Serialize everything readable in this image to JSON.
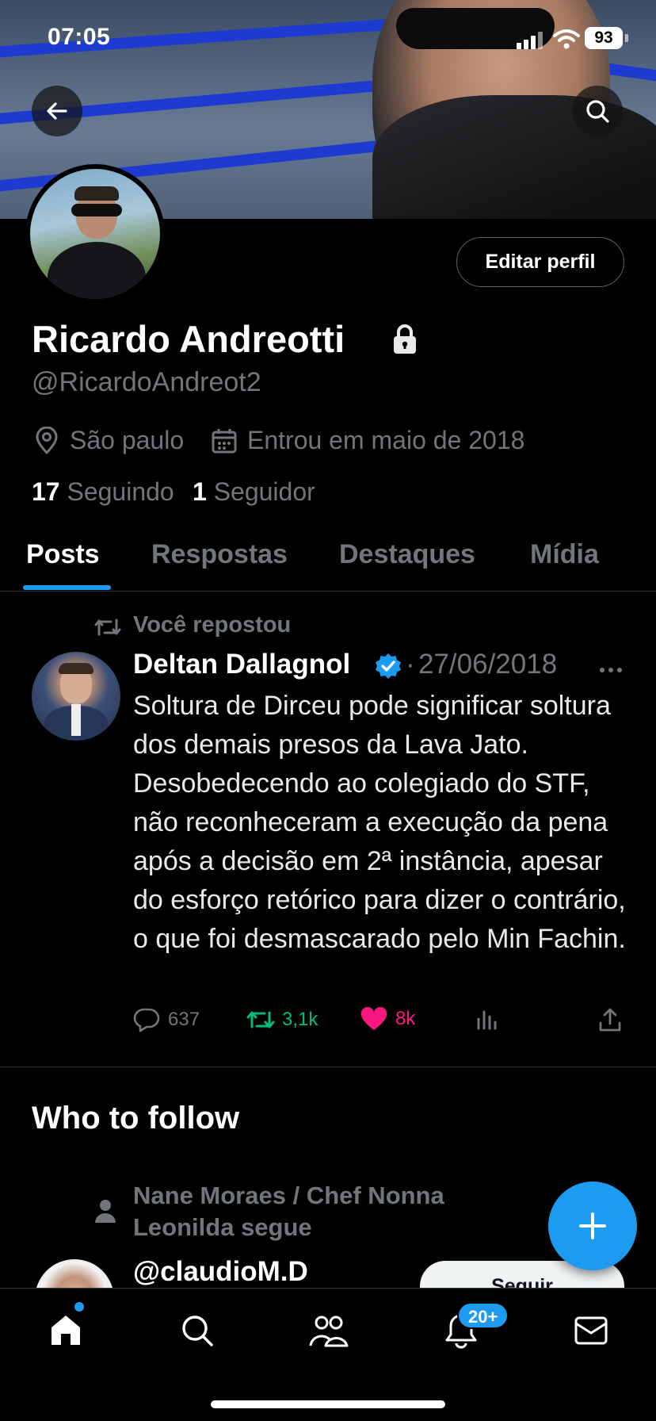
{
  "status_bar": {
    "time": "07:05",
    "battery": "93"
  },
  "profile": {
    "name": "Ricardo Andreotti",
    "handle": "@RicardoAndreot2",
    "location": "São paulo",
    "joined": "Entrou em maio de 2018",
    "following_count": "17",
    "following_label": "Seguindo",
    "followers_count": "1",
    "followers_label": "Seguidor",
    "edit_button": "Editar perfil",
    "protected": true
  },
  "tabs": [
    {
      "label": "Posts",
      "active": true
    },
    {
      "label": "Respostas",
      "active": false
    },
    {
      "label": "Destaques",
      "active": false
    },
    {
      "label": "Mídia",
      "active": false
    }
  ],
  "tweet": {
    "repost_label": "Você repostou",
    "author": "Deltan Dallagnol",
    "verified": true,
    "separator": "·",
    "date": "27/06/2018",
    "text": "Soltura de Dirceu pode significar soltura dos demais presos da Lava Jato. Desobedecendo ao colegiado do STF, não reconheceram a execução da pena após a decisão em 2ª instância, apesar do esforço retórico para dizer o contrário, o que foi desmascarado pelo Min Fachin.",
    "replies": "637",
    "reposts": "3,1k",
    "likes": "8k"
  },
  "who_to_follow": {
    "title": "Who to follow",
    "social_context": "Nane Moraes / Chef Nonna Leonilda segue",
    "handle": "@claudioM.D",
    "follow_button": "Seguir"
  },
  "tab_bar": {
    "notifications_badge": "20+"
  },
  "colors": {
    "accent": "#1d9bf0",
    "like": "#f91880",
    "repost": "#00ba7c",
    "muted": "#71767b"
  }
}
